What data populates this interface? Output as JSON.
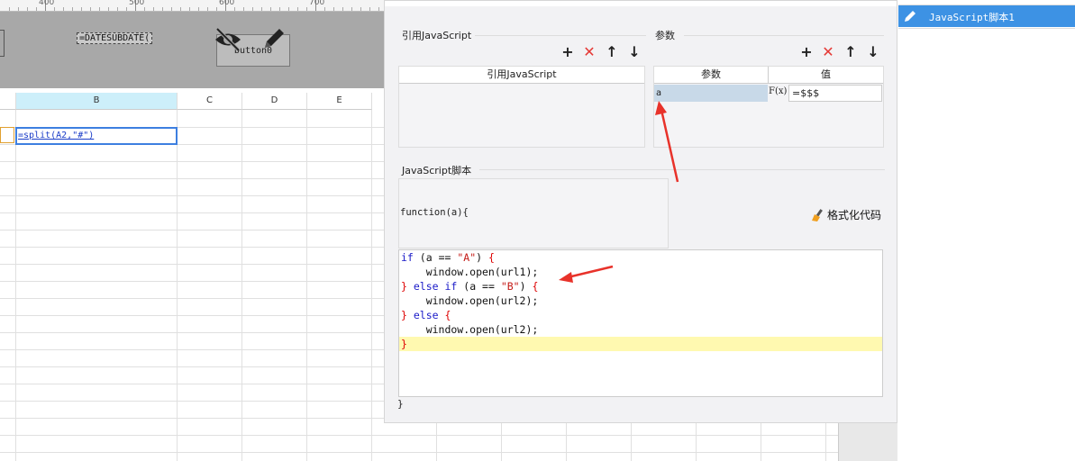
{
  "ruler": {
    "labels": [
      "400",
      "500",
      "600",
      "700"
    ]
  },
  "canvas": {
    "formula_widget": "=DATESUBDATE(",
    "button_widget": "button0"
  },
  "sheet": {
    "columns": [
      "B",
      "C",
      "D",
      "E"
    ],
    "formula_cell": "=split(A2,\"#\")"
  },
  "dialog": {
    "ref_section_title": "引用JavaScript",
    "ref_table_header": "引用JavaScript",
    "param_section_title": "参数",
    "param_col_name": "参数",
    "param_col_value": "值",
    "param_rows": [
      {
        "name": "a",
        "value": "=$$$"
      }
    ],
    "formula_btn": "F(x)",
    "script_section_title": "JavaScript脚本",
    "function_signature": "function(a){",
    "format_code_label": "格式化代码",
    "code_lines": [
      "if (a == \"A\") {",
      "    window.open(url1);",
      "} else if (a == \"B\") {",
      "    window.open(url2);",
      "} else {",
      "    window.open(url2);",
      "}"
    ],
    "closing_brace": "}"
  },
  "sidebar": {
    "item_label": "JavaScript脚本1"
  },
  "colors": {
    "accent": "#3d92e4",
    "annotation_arrow": "#e8322a",
    "highlight_line": "#fff9b0"
  }
}
